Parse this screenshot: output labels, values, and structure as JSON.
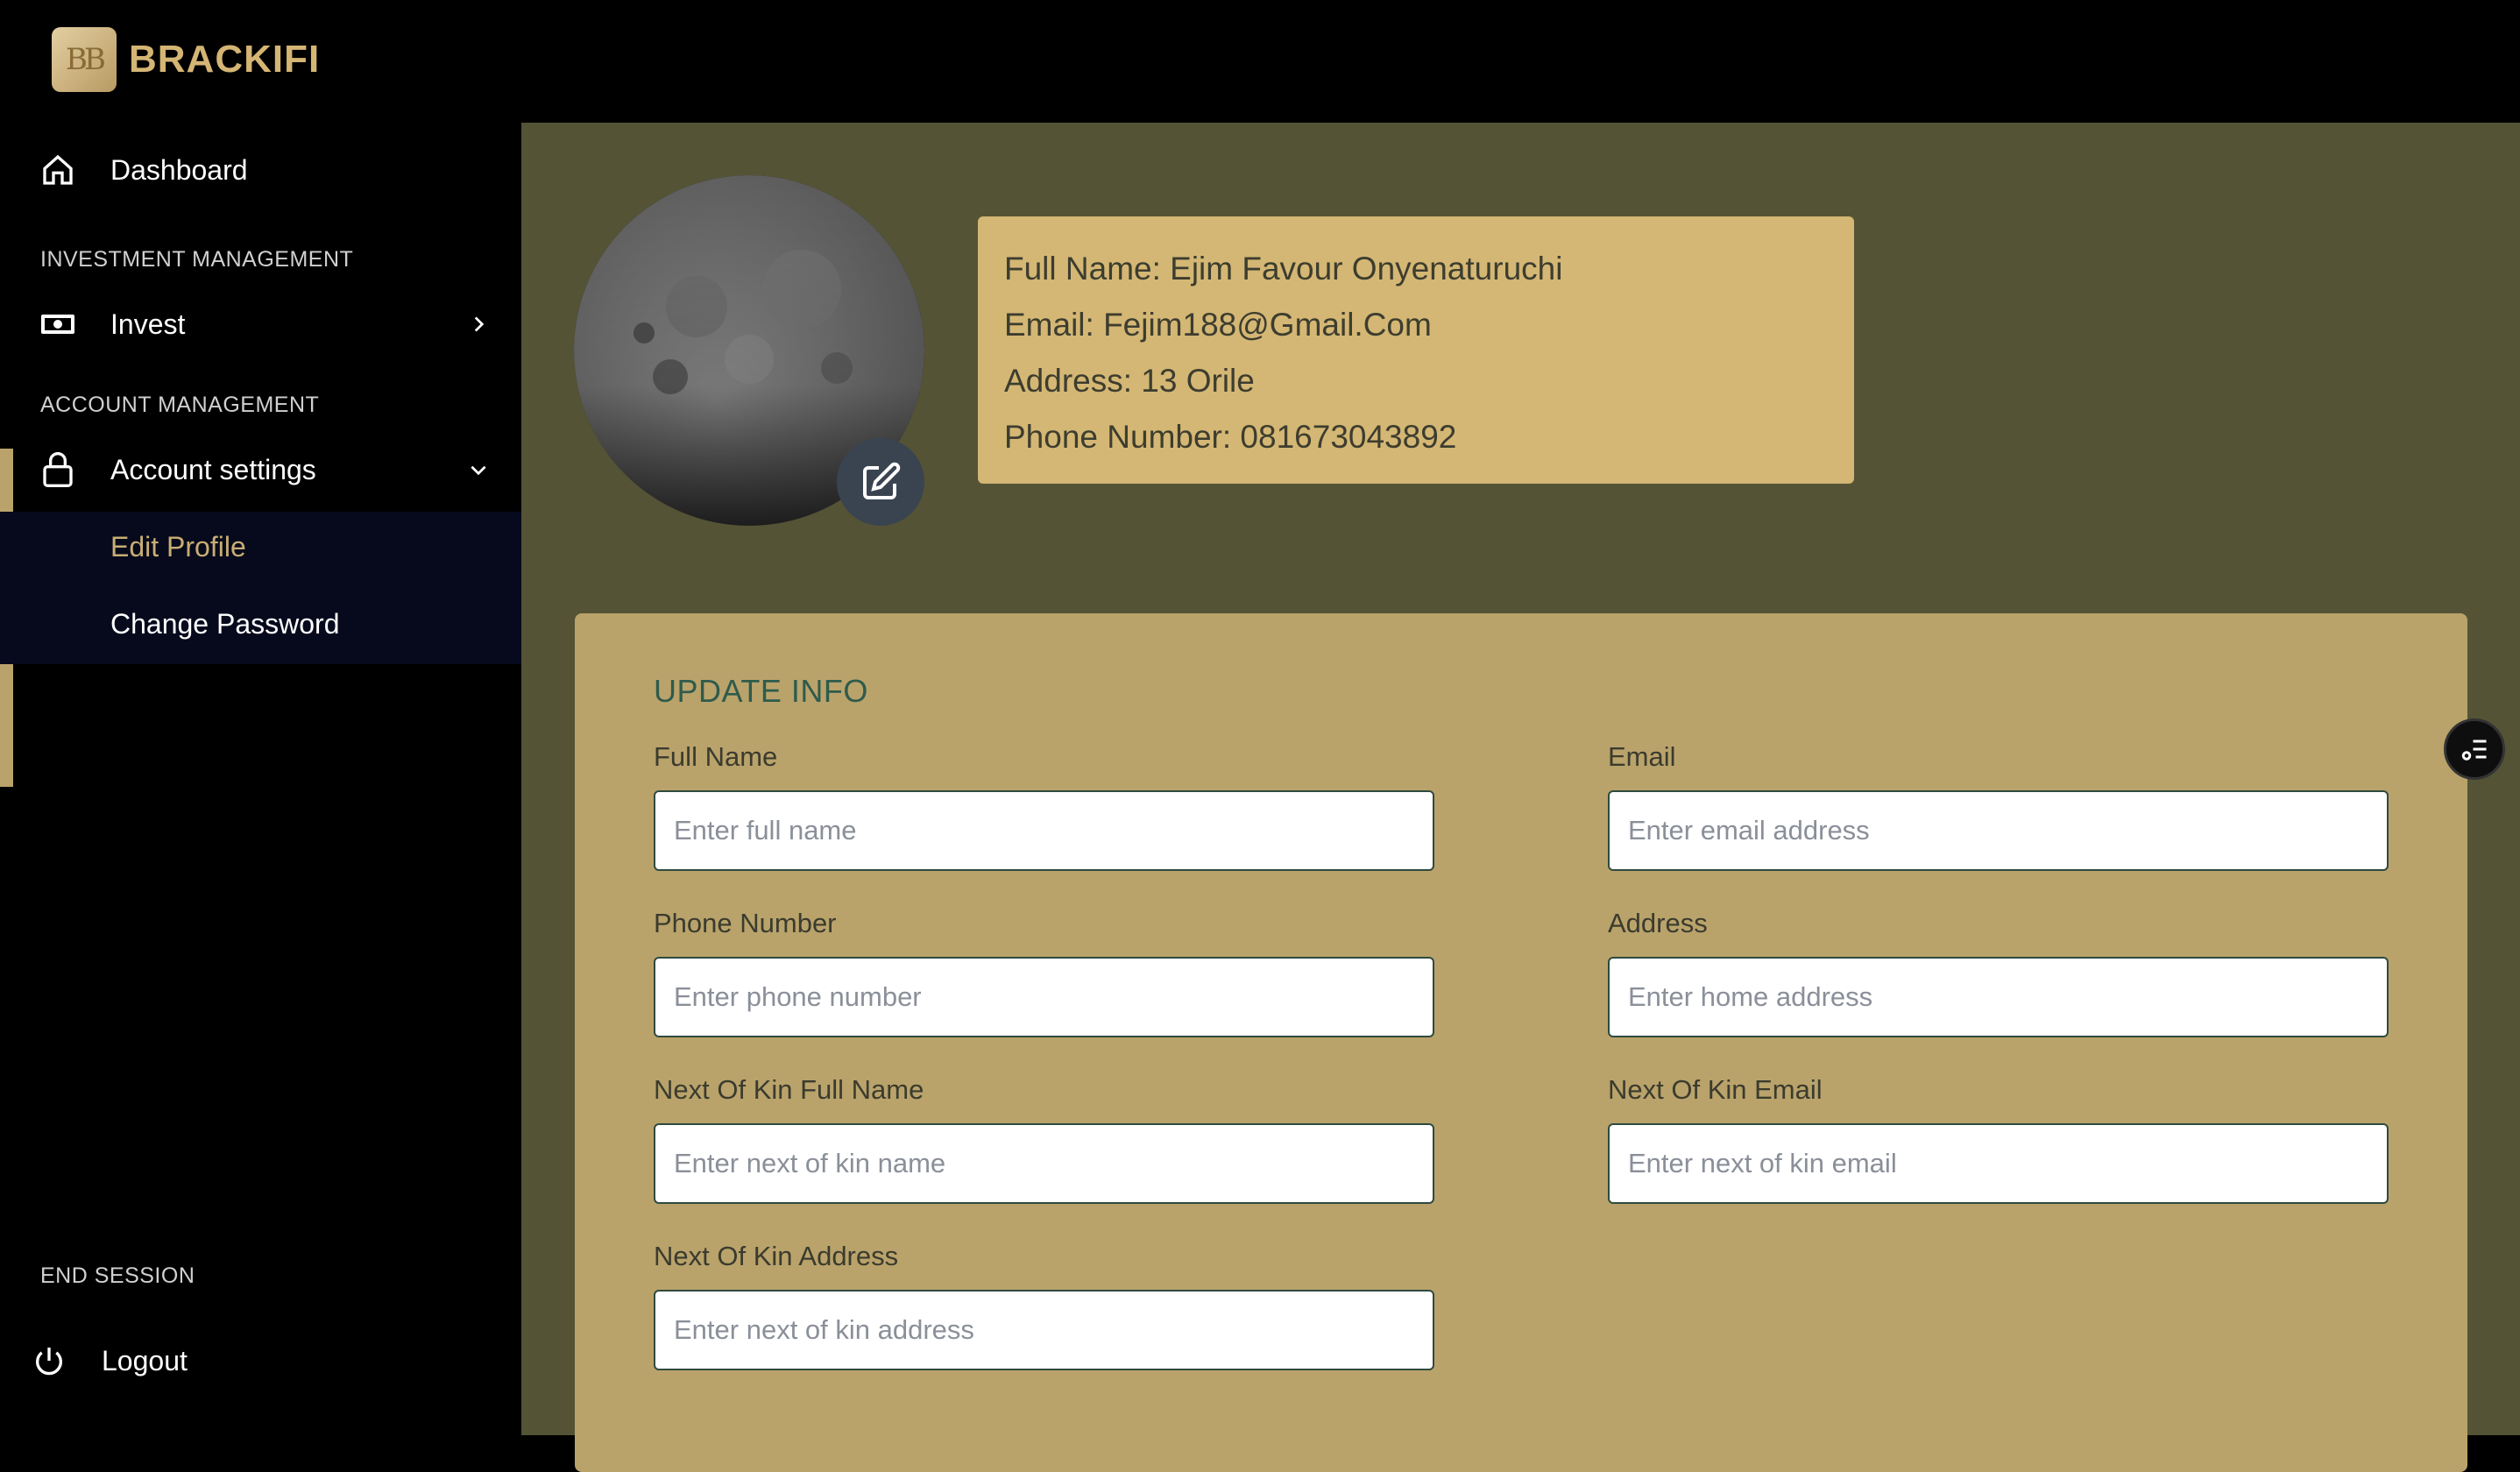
{
  "brand": {
    "logo_text": "BB",
    "name": "BRACKIFI"
  },
  "sidebar": {
    "dashboard_label": "Dashboard",
    "section_investment": "INVESTMENT MANAGEMENT",
    "invest_label": "Invest",
    "section_account": "ACCOUNT MANAGEMENT",
    "account_settings_label": "Account settings",
    "submenu": {
      "edit_profile": "Edit Profile",
      "change_password": "Change Password"
    },
    "section_end": "END SESSION",
    "logout_label": "Logout",
    "icons": {
      "dashboard": "home-icon",
      "invest": "money-icon",
      "account": "lock-icon",
      "logout": "power-icon"
    }
  },
  "profile": {
    "full_name_line": "Full Name: Ejim Favour Onyenaturuchi",
    "email_line": "Email: Fejim188@Gmail.Com",
    "address_line": "Address: 13 Orile",
    "phone_line": "Phone Number: 081673043892"
  },
  "form": {
    "title": "UPDATE INFO",
    "full_name": {
      "label": "Full Name",
      "placeholder": "Enter full name"
    },
    "email": {
      "label": "Email",
      "placeholder": "Enter email address"
    },
    "phone": {
      "label": "Phone Number",
      "placeholder": "Enter phone number"
    },
    "address": {
      "label": "Address",
      "placeholder": "Enter home address"
    },
    "kin_name": {
      "label": "Next Of Kin Full Name",
      "placeholder": "Enter next of kin name"
    },
    "kin_email": {
      "label": "Next Of Kin Email",
      "placeholder": "Enter next of kin email"
    },
    "kin_address": {
      "label": "Next Of Kin Address",
      "placeholder": "Enter next of kin address"
    }
  },
  "colors": {
    "accent_gold": "#d4b774",
    "form_bg": "#b9a36b",
    "main_bg": "#545335",
    "title_green": "#2f5b4c"
  }
}
